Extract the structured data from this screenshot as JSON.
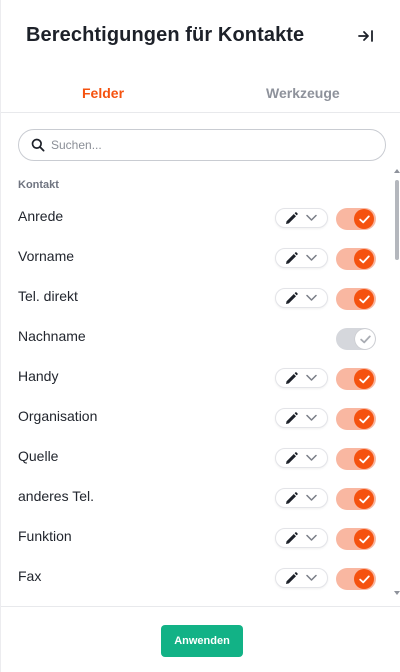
{
  "header": {
    "title": "Berechtigungen für Kontakte",
    "collapse_icon": "collapse-right-icon"
  },
  "tabs": [
    {
      "label": "Felder",
      "active": true
    },
    {
      "label": "Werkzeuge",
      "active": false
    }
  ],
  "search": {
    "placeholder": "Suchen...",
    "value": ""
  },
  "section": {
    "label": "Kontakt"
  },
  "fields": [
    {
      "label": "Anrede",
      "editable": true,
      "enabled": true
    },
    {
      "label": "Vorname",
      "editable": true,
      "enabled": true
    },
    {
      "label": "Tel. direkt",
      "editable": true,
      "enabled": true
    },
    {
      "label": "Nachname",
      "editable": false,
      "enabled": false
    },
    {
      "label": "Handy",
      "editable": true,
      "enabled": true
    },
    {
      "label": "Organisation",
      "editable": true,
      "enabled": true
    },
    {
      "label": "Quelle",
      "editable": true,
      "enabled": true
    },
    {
      "label": "anderes Tel.",
      "editable": true,
      "enabled": true
    },
    {
      "label": "Funktion",
      "editable": true,
      "enabled": true
    },
    {
      "label": "Fax",
      "editable": true,
      "enabled": true
    }
  ],
  "footer": {
    "apply_label": "Anwenden"
  },
  "colors": {
    "accent": "#f5520f",
    "toggle_on_track": "#f9b7a1",
    "toggle_off_track": "#d5d7dc",
    "apply_button": "#12b286"
  }
}
